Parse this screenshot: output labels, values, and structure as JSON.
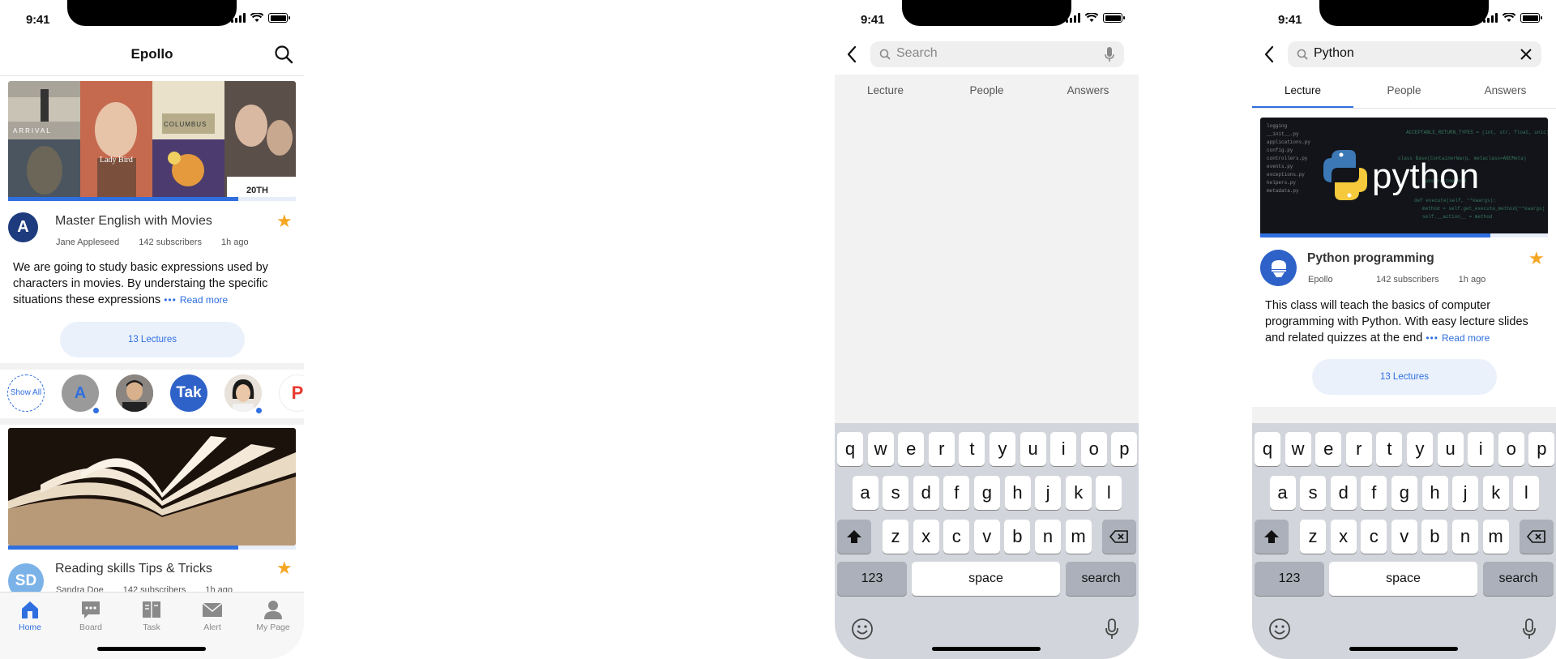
{
  "status": {
    "time": "9:41"
  },
  "home": {
    "app_title": "Epollo",
    "card1": {
      "avatar_letter": "A",
      "title": "Master English with Movies",
      "author": "Jane Appleseed",
      "subscribers": "142 subscribers",
      "time": "1h ago",
      "description": "We are going to study basic expressions used by characters in movies. By understaing the specific situations these expressions",
      "read_more": "Read more",
      "lectures": "13 Lectures",
      "progress": 0.8,
      "poster_texts": [
        "ARRIVAL",
        "Lady Bird",
        "COLUMBUS",
        "20TH"
      ]
    },
    "stories": {
      "show_all": "Show All",
      "letter": "A",
      "tak": "Tak"
    },
    "card2": {
      "avatar_letters": "SD",
      "title": "Reading skills Tips & Tricks",
      "author": "Sandra Doe",
      "subscribers": "142 subscribers",
      "time": "1h ago",
      "progress": 0.8
    },
    "tabbar": [
      {
        "label": "Home",
        "icon": "home-icon"
      },
      {
        "label": "Board",
        "icon": "board-icon"
      },
      {
        "label": "Task",
        "icon": "task-icon"
      },
      {
        "label": "Alert",
        "icon": "alert-icon"
      },
      {
        "label": "My Page",
        "icon": "profile-icon"
      }
    ]
  },
  "search_empty": {
    "placeholder": "Search",
    "tabs": [
      "Lecture",
      "People",
      "Answers"
    ]
  },
  "search_result": {
    "query": "Python",
    "tabs": [
      "Lecture",
      "People",
      "Answers"
    ],
    "card": {
      "image_text": "python",
      "title": "Python programming",
      "author": "Epollo",
      "subscribers": "142 subscribers",
      "time": "1h ago",
      "description": "This class will teach the basics of computer programming with Python. With easy lecture slides and related quizzes at the end",
      "read_more": "Read more",
      "lectures": "13 Lectures",
      "progress": 0.8
    }
  },
  "keyboard": {
    "row1": [
      "q",
      "w",
      "e",
      "r",
      "t",
      "y",
      "u",
      "i",
      "o",
      "p"
    ],
    "row2": [
      "a",
      "s",
      "d",
      "f",
      "g",
      "h",
      "j",
      "k",
      "l"
    ],
    "row3": [
      "z",
      "x",
      "c",
      "v",
      "b",
      "n",
      "m"
    ],
    "numbers": "123",
    "space": "space",
    "search": "search"
  },
  "colors": {
    "accent": "#2f6fe0",
    "star": "#f5a623"
  }
}
